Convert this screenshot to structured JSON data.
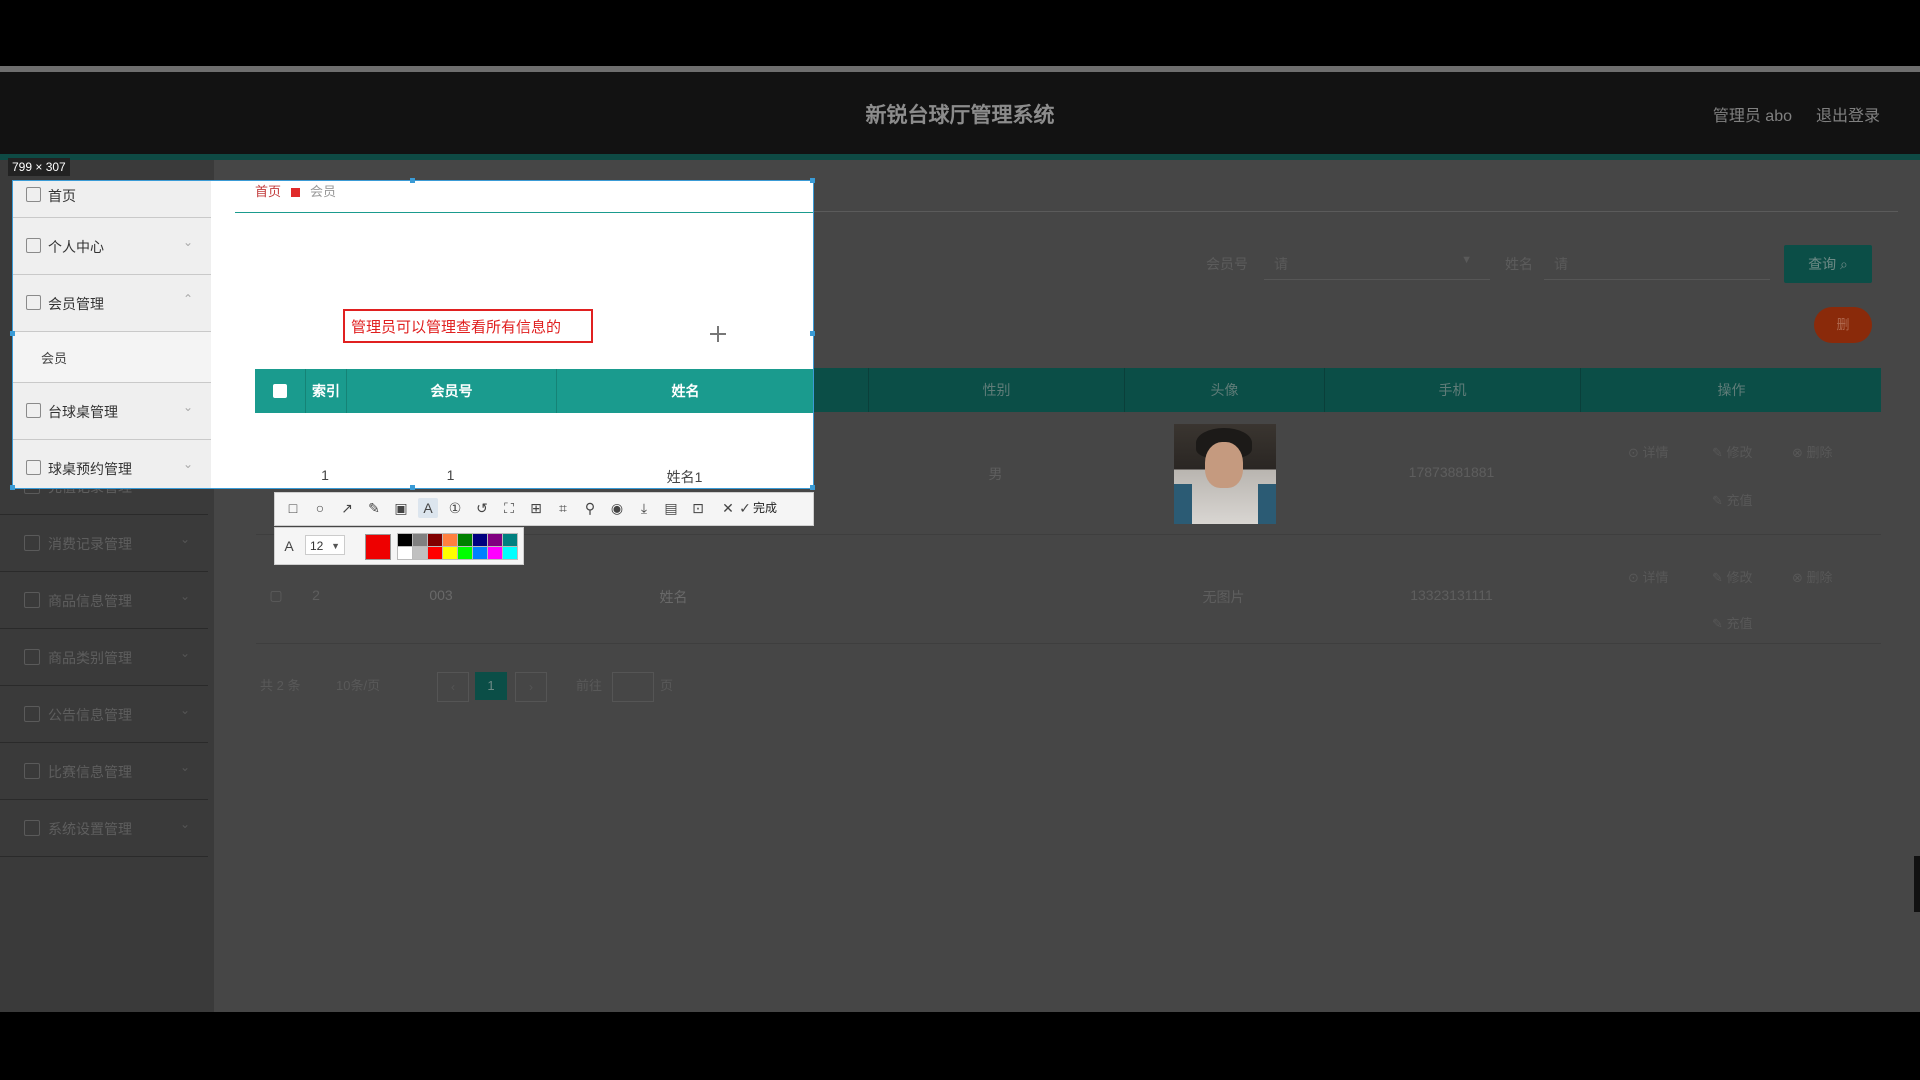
{
  "app": {
    "title": "新锐台球厅管理系统",
    "user_label": "管理员 abo",
    "logout_label": "退出登录"
  },
  "sidebar_dim": [
    {
      "label": "首页",
      "icon": "home-icon"
    },
    {
      "label": "个人中心",
      "icon": "user-icon"
    },
    {
      "label": "会员管理",
      "icon": "member-icon"
    },
    {
      "label": "台球桌管理",
      "icon": "table-icon"
    },
    {
      "label": "球桌预约管理",
      "icon": "calendar-icon"
    },
    {
      "label": "充值记录管理",
      "icon": "record-icon"
    },
    {
      "label": "消费记录管理",
      "icon": "chart-icon"
    },
    {
      "label": "商品信息管理",
      "icon": "goods-icon"
    },
    {
      "label": "商品类别管理",
      "icon": "category-icon"
    },
    {
      "label": "公告信息管理",
      "icon": "notice-icon"
    },
    {
      "label": "比赛信息管理",
      "icon": "trophy-icon"
    },
    {
      "label": "系统设置管理",
      "icon": "setting-icon"
    }
  ],
  "selection": {
    "size_label": "799 × 307",
    "sidebar": [
      {
        "label": "首页"
      },
      {
        "label": "个人中心"
      },
      {
        "label": "会员管理"
      }
    ],
    "submenu": "会员",
    "sidebar_more": [
      {
        "label": "台球桌管理"
      },
      {
        "label": "球桌预约管理"
      }
    ],
    "breadcrumb_home": "首页",
    "breadcrumb_current": "会员",
    "annotation": "管理员可以管理查看所有信息的",
    "headers": [
      "索引",
      "会员号",
      "姓名"
    ],
    "row1": {
      "index": "1",
      "member_no": "1",
      "name": "姓名1"
    }
  },
  "search": {
    "label1": "会员号",
    "placeholder1": "请",
    "label2": "姓名",
    "placeholder2": "请",
    "button": "查询"
  },
  "delete_button": "删",
  "table": {
    "headers_dim": [
      "性别",
      "头像",
      "手机",
      "操作"
    ],
    "rows": [
      {
        "gender": "男",
        "phone": "17873881881",
        "ops": [
          "详情",
          "修改",
          "删除",
          "充值"
        ]
      },
      {
        "index": "2",
        "member_no": "003",
        "name": "姓名",
        "avatar_text": "无图片",
        "phone": "13323131111",
        "ops": [
          "详情",
          "修改",
          "删除",
          "充值"
        ]
      }
    ]
  },
  "pagination": {
    "total": "共 2 条",
    "page_size": "10条/页",
    "current": "1",
    "goto_label": "前往",
    "page_unit": "页"
  },
  "toolbar": {
    "done": "完成",
    "font_size": "12",
    "current_color": "#ee0000",
    "swatches": [
      "#000000",
      "#808080",
      "#800000",
      "#ff8040",
      "#008000",
      "#000080",
      "#800080",
      "#008080",
      "#ffffff",
      "#c0c0c0",
      "#ff0000",
      "#ffff00",
      "#00ff00",
      "#0080ff",
      "#ff00ff",
      "#00ffff"
    ]
  }
}
